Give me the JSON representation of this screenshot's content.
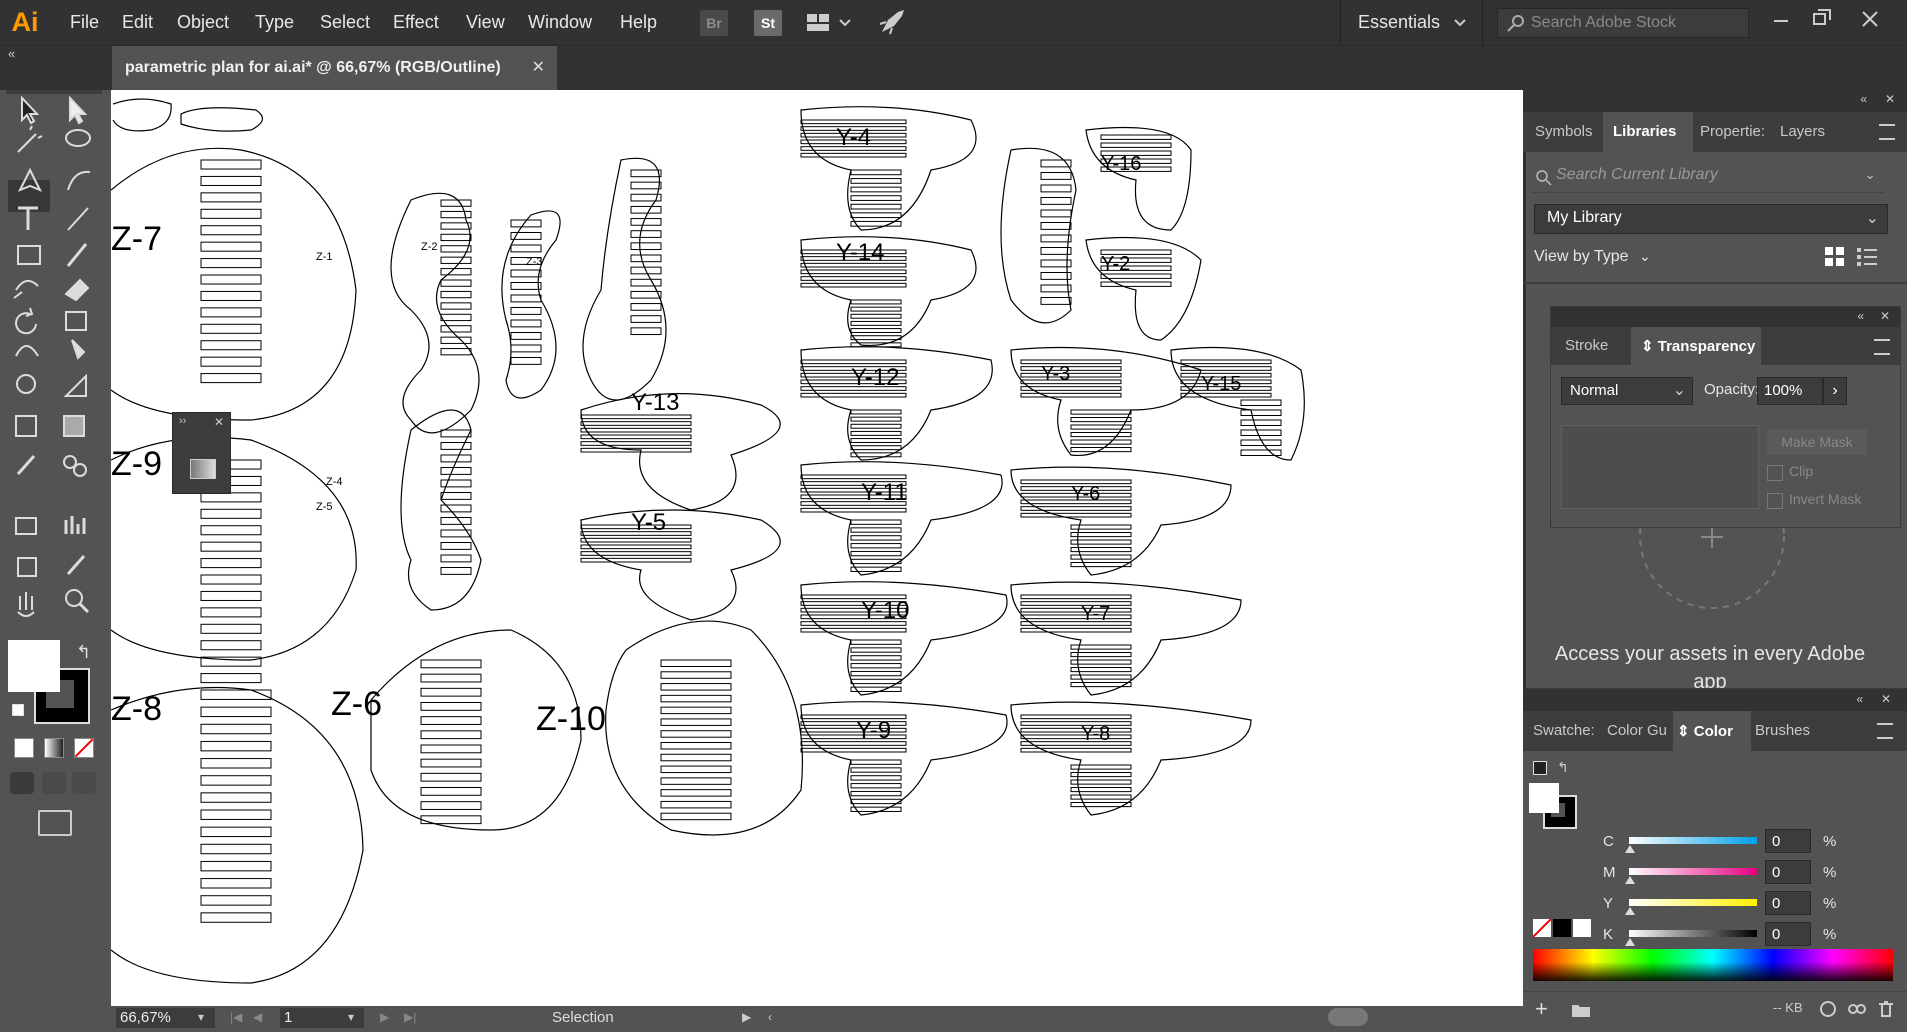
{
  "app": {
    "logo": "Ai"
  },
  "menu": [
    "File",
    "Edit",
    "Object",
    "Type",
    "Select",
    "Effect",
    "View",
    "Window",
    "Help"
  ],
  "toolbar_buttons": {
    "br": "Br",
    "st": "St"
  },
  "workspace": {
    "label": "Essentials"
  },
  "stock_search": {
    "placeholder": "Search Adobe Stock"
  },
  "document": {
    "tab_title": "parametric plan for ai.ai* @ 66,67% (RGB/Outline)"
  },
  "status": {
    "zoom": "66,67%",
    "page": "1",
    "tool": "Selection"
  },
  "libraries_panel": {
    "tabs": [
      "Symbols",
      "Libraries",
      "Propertie:",
      "Layers"
    ],
    "active_tab": "Libraries",
    "search_placeholder": "Search Current Library",
    "library_name": "My Library",
    "view_by": "View by Type",
    "promo": "Access your assets in every Adobe app"
  },
  "transparency_panel": {
    "tabs": [
      "Stroke",
      "Transparency"
    ],
    "active_tab": "Transparency",
    "blend_mode": "Normal",
    "opacity_label": "Opacity:",
    "opacity_value": "100%",
    "make_mask": "Make Mask",
    "clip": "Clip",
    "invert_mask": "Invert Mask"
  },
  "color_panel": {
    "tabs": [
      "Swatche:",
      "Color Gu",
      "Color",
      "Brushes"
    ],
    "active_tab": "Color",
    "channels": [
      {
        "label": "C",
        "value": "0",
        "unit": "%",
        "color": "#00a0e9"
      },
      {
        "label": "M",
        "value": "0",
        "unit": "%",
        "color": "#e4007f"
      },
      {
        "label": "Y",
        "value": "0",
        "unit": "%",
        "color": "#fff100"
      },
      {
        "label": "K",
        "value": "0",
        "unit": "%",
        "color": "#000000"
      }
    ]
  },
  "bottom_panel": {
    "size_label": "-- KB"
  },
  "artboard": {
    "z_labels": [
      "Z-7",
      "Z-9",
      "Z-8",
      "Z-6",
      "Z-10",
      "Z-1",
      "Z-2",
      "Z-3",
      "Z-4",
      "Z-5"
    ],
    "y_labels": [
      "Y-4",
      "Y-14",
      "Y-12",
      "Y-11",
      "Y-10",
      "Y-9",
      "Y-13",
      "Y-5",
      "Y-16",
      "Y-2",
      "Y-3",
      "Y-15",
      "Y-6",
      "Y-7",
      "Y-8"
    ]
  }
}
